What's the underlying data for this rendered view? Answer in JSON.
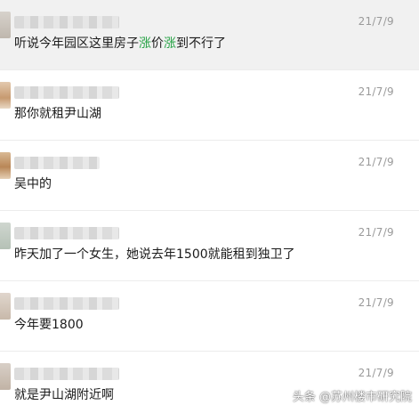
{
  "messages": [
    {
      "date": "21/7/9",
      "text_parts": [
        "听说今年园区这里房子",
        "涨",
        "价",
        "涨",
        "到不行了"
      ],
      "highlight_color": "#25a244"
    },
    {
      "date": "21/7/9",
      "text": "那你就租尹山湖"
    },
    {
      "date": "21/7/9",
      "text": "吴中的"
    },
    {
      "date": "21/7/9",
      "text": "昨天加了一个女生，她说去年1500就能租到独卫了"
    },
    {
      "date": "21/7/9",
      "text": "今年要1800"
    },
    {
      "date": "21/7/9",
      "text": "就是尹山湖附近啊"
    }
  ],
  "watermark": "头条 @苏州楼市研究院"
}
